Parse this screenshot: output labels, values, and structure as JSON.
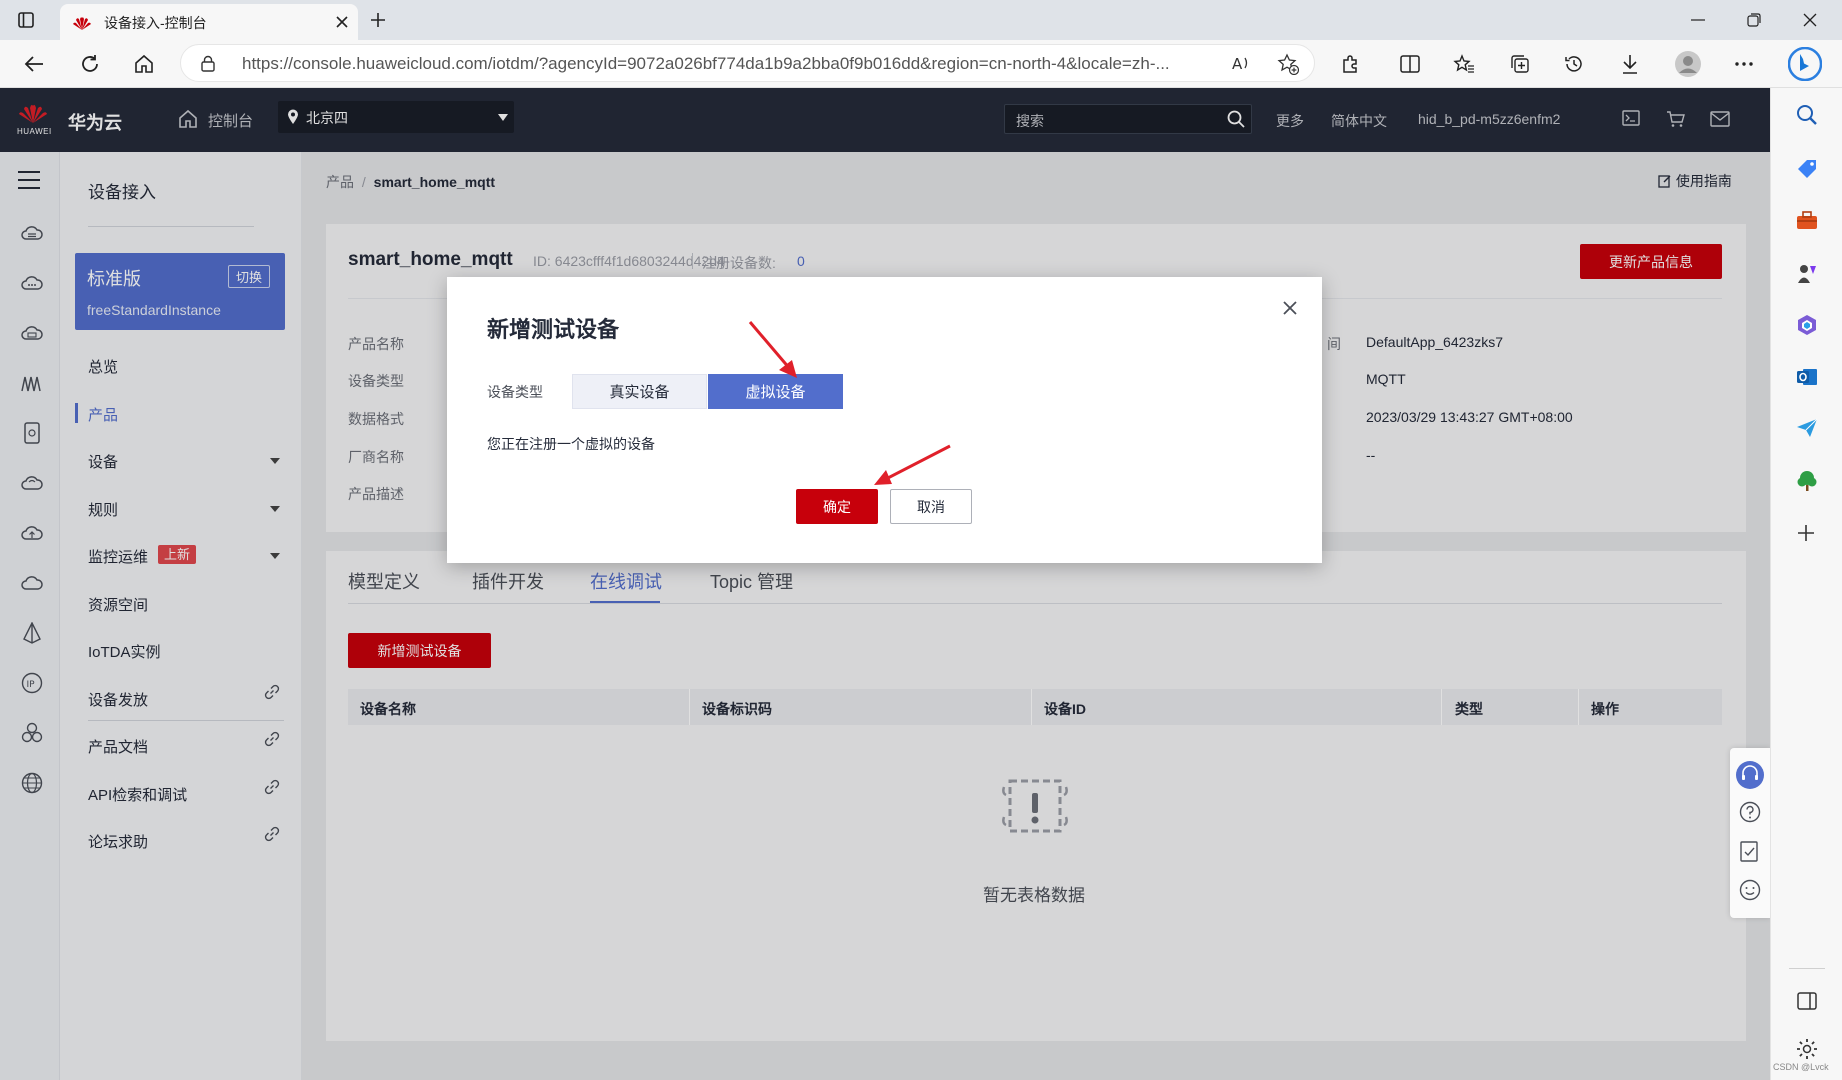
{
  "browser": {
    "tab_title": "设备接入-控制台",
    "url": "https://console.huaweicloud.com/iotdm/?agencyId=9072a026bf774da1b9a2bba0f9b016dd&region=cn-north-4&locale=zh-..."
  },
  "header": {
    "brand": "华为云",
    "brand_small": "HUAWEI",
    "console_label": "控制台",
    "region": "北京四",
    "search_placeholder": "搜索",
    "more": "更多",
    "language": "简体中文",
    "username": "hid_b_pd-m5zz6enfm2"
  },
  "nav": {
    "title": "设备接入",
    "edition": "标准版",
    "switch_label": "切换",
    "instance": "freeStandardInstance",
    "items": [
      {
        "label": "总览"
      },
      {
        "label": "产品"
      },
      {
        "label": "设备"
      },
      {
        "label": "规则"
      },
      {
        "label": "监控运维",
        "badge": "上新"
      },
      {
        "label": "资源空间"
      },
      {
        "label": "IoTDA实例"
      },
      {
        "label": "设备发放"
      },
      {
        "label": "产品文档"
      },
      {
        "label": "API检索和调试"
      },
      {
        "label": "论坛求助"
      }
    ]
  },
  "breadcrumb": {
    "parent": "产品",
    "sep": "/",
    "current": "smart_home_mqtt"
  },
  "guide": "使用指南",
  "product": {
    "name": "smart_home_mqtt",
    "id_label": "ID: 6423cfff4f1d6803244d42d4",
    "reg_label": "注册设备数:",
    "reg_count": "0",
    "update_button": "更新产品信息",
    "fields": [
      {
        "label": "产品名称"
      },
      {
        "label": "设备类型"
      },
      {
        "label": "数据格式"
      },
      {
        "label": "厂商名称"
      },
      {
        "label": "产品描述"
      }
    ],
    "right_label_fragment": "间",
    "right_values": [
      "DefaultApp_6423zks7",
      "MQTT",
      "2023/03/29 13:43:27 GMT+08:00",
      "--"
    ]
  },
  "tabs": [
    "模型定义",
    "插件开发",
    "在线调试",
    "Topic 管理"
  ],
  "add_device_button": "新增测试设备",
  "table": {
    "columns": [
      "设备名称",
      "设备标识码",
      "设备ID",
      "类型",
      "操作"
    ],
    "empty_text": "暂无表格数据"
  },
  "modal": {
    "title": "新增测试设备",
    "device_type_label": "设备类型",
    "option_real": "真实设备",
    "option_virtual": "虚拟设备",
    "message": "您正在注册一个虚拟的设备",
    "confirm": "确定",
    "cancel": "取消"
  },
  "watermark": "CSDN @Lvck",
  "colors": {
    "brand_red": "#c7000b",
    "accent_blue": "#526ecc",
    "header_bg": "#252b3a",
    "arrow_red": "#e0202a"
  }
}
